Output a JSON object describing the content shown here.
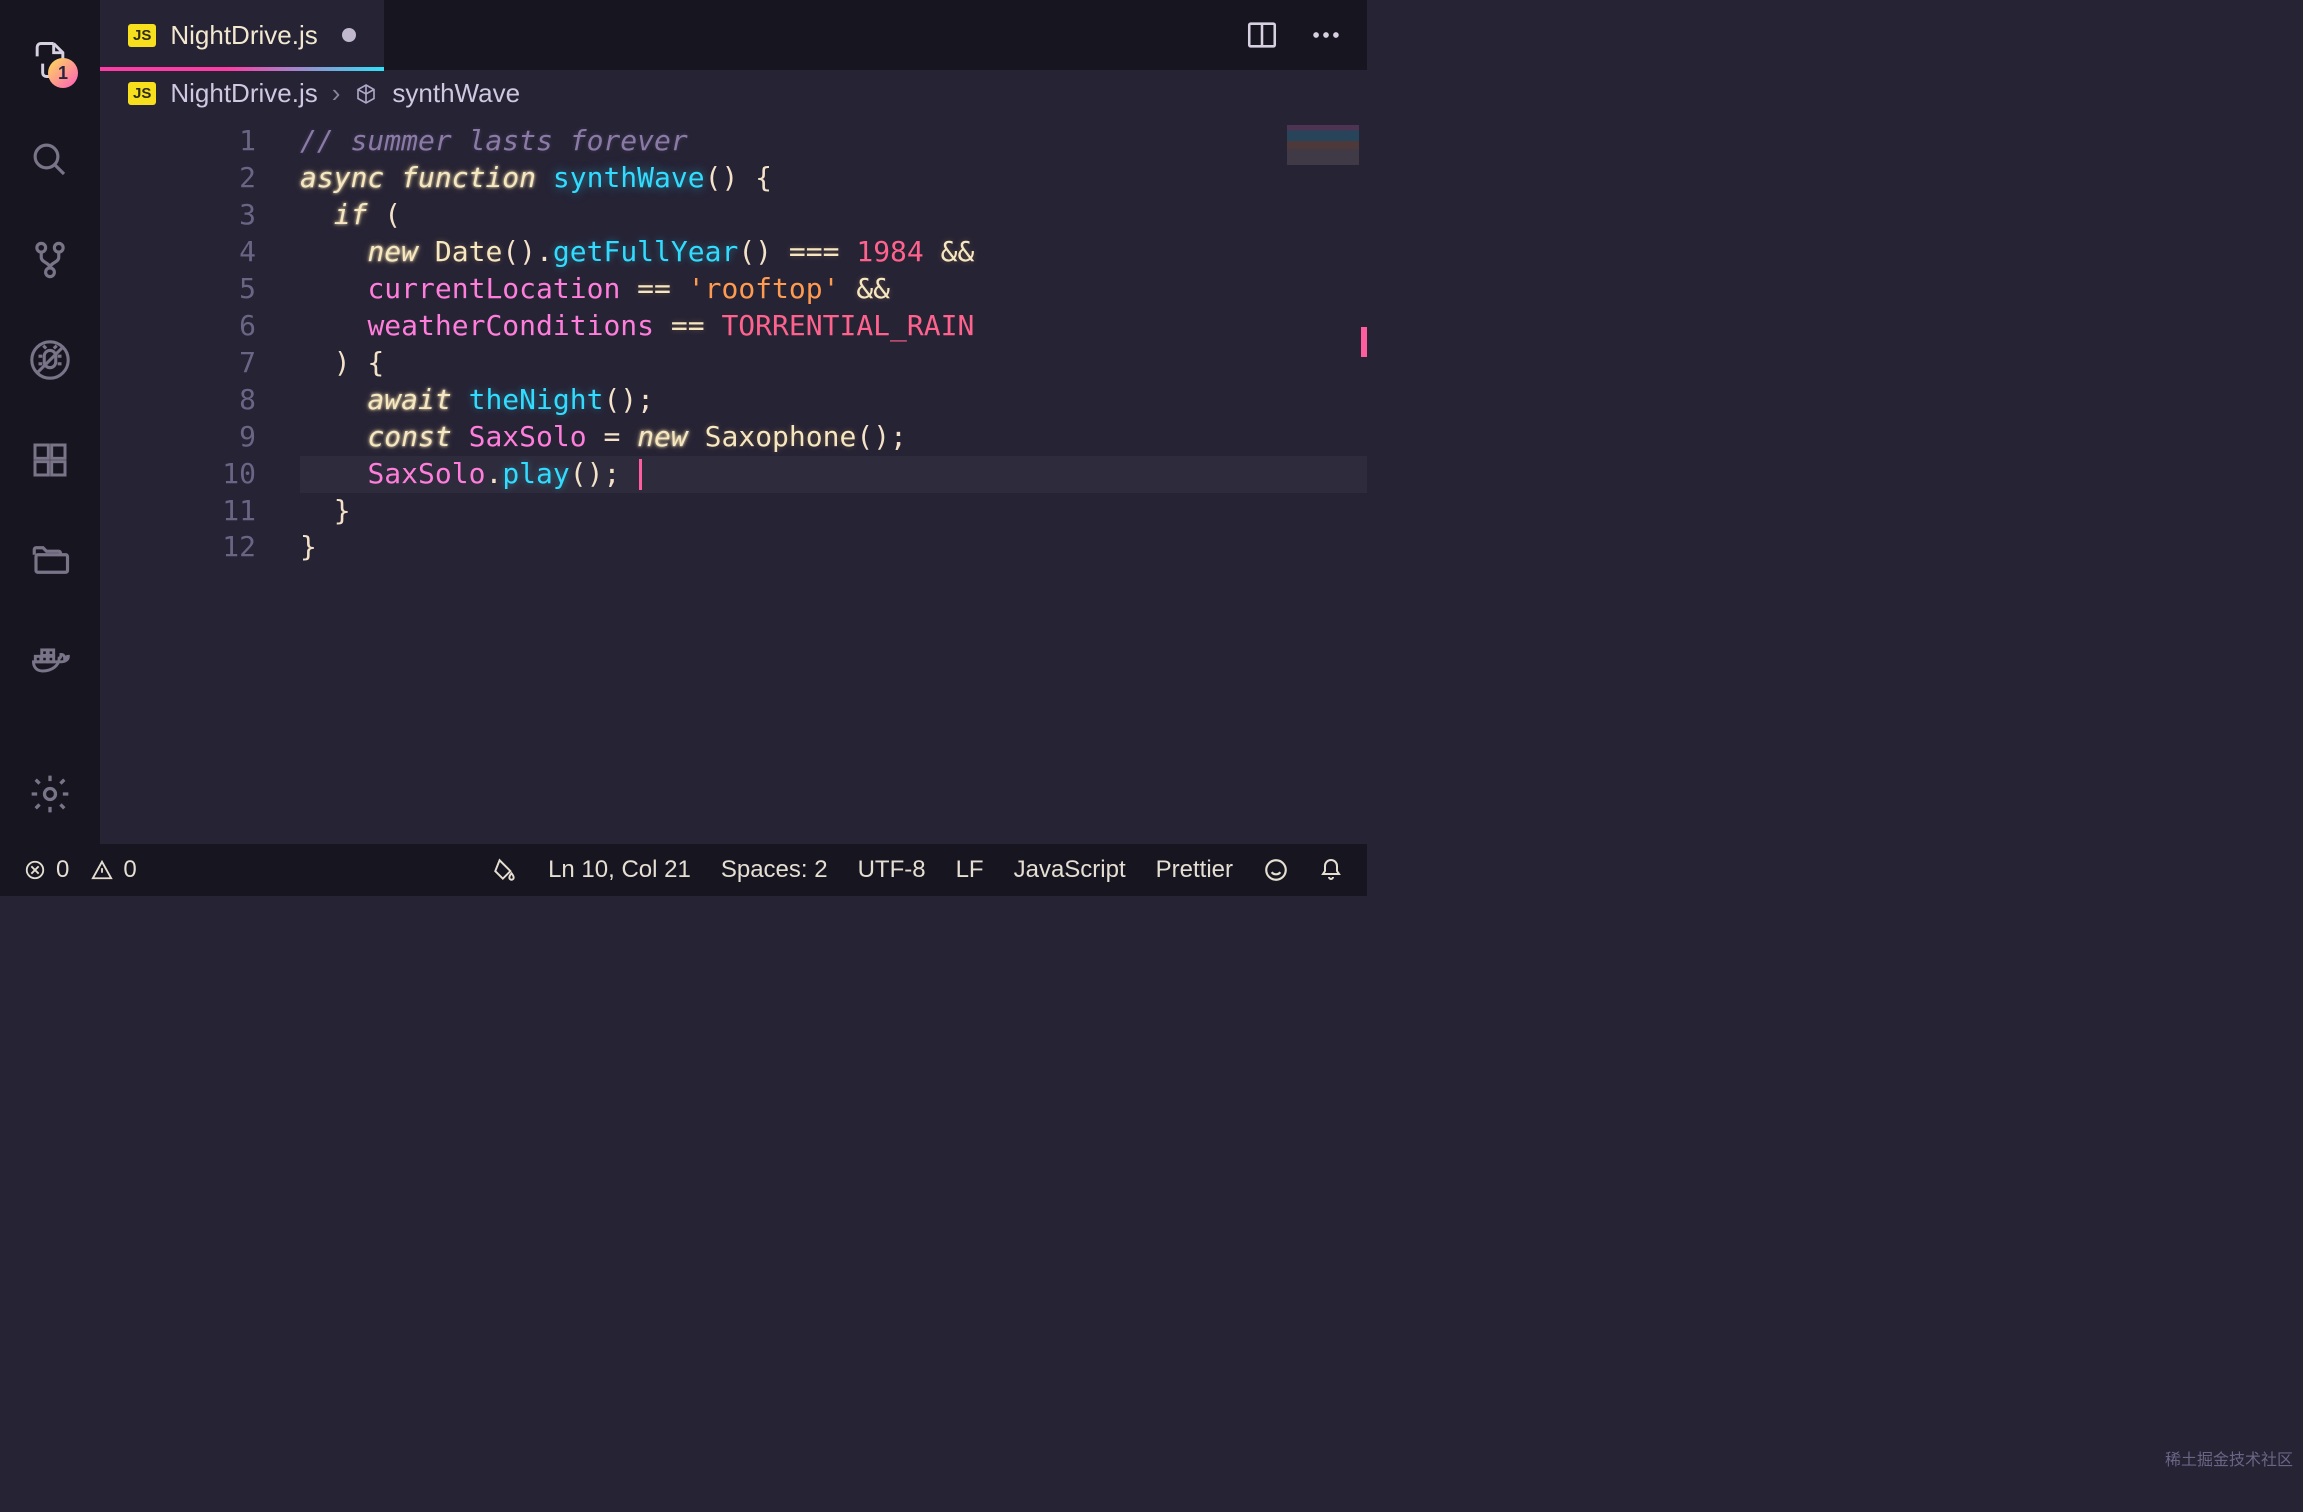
{
  "activitybar": {
    "badgeCount": "1"
  },
  "tab": {
    "fileName": "NightDrive.js",
    "lang": "JS"
  },
  "breadcrumb": {
    "file": "NightDrive.js",
    "symbol": "synthWave",
    "fileLang": "JS"
  },
  "editor": {
    "activeLine": 10,
    "lines": [
      {
        "n": "1",
        "tokens": [
          {
            "t": "// summer lasts forever",
            "c": "c-comment"
          }
        ]
      },
      {
        "n": "2",
        "tokens": [
          {
            "t": "async",
            "c": "c-kw"
          },
          {
            "t": " "
          },
          {
            "t": "function",
            "c": "c-kw"
          },
          {
            "t": " "
          },
          {
            "t": "synthWave",
            "c": "c-func"
          },
          {
            "t": "() {",
            "c": "c-punc"
          }
        ]
      },
      {
        "n": "3",
        "tokens": [
          {
            "t": "  "
          },
          {
            "t": "if",
            "c": "c-kw"
          },
          {
            "t": " (",
            "c": "c-punc"
          }
        ]
      },
      {
        "n": "4",
        "tokens": [
          {
            "t": "    "
          },
          {
            "t": "new",
            "c": "c-kw"
          },
          {
            "t": " "
          },
          {
            "t": "Date",
            "c": "c-type"
          },
          {
            "t": "().",
            "c": "c-punc"
          },
          {
            "t": "getFullYear",
            "c": "c-call"
          },
          {
            "t": "() ",
            "c": "c-punc"
          },
          {
            "t": "===",
            "c": "c-op"
          },
          {
            "t": " "
          },
          {
            "t": "1984",
            "c": "c-num"
          },
          {
            "t": " "
          },
          {
            "t": "&&",
            "c": "c-op"
          }
        ]
      },
      {
        "n": "5",
        "tokens": [
          {
            "t": "    "
          },
          {
            "t": "currentLocation",
            "c": "c-var"
          },
          {
            "t": " "
          },
          {
            "t": "==",
            "c": "c-op"
          },
          {
            "t": " "
          },
          {
            "t": "'rooftop'",
            "c": "c-str"
          },
          {
            "t": " "
          },
          {
            "t": "&&",
            "c": "c-op"
          }
        ]
      },
      {
        "n": "6",
        "tokens": [
          {
            "t": "    "
          },
          {
            "t": "weatherConditions",
            "c": "c-var"
          },
          {
            "t": " "
          },
          {
            "t": "==",
            "c": "c-op"
          },
          {
            "t": " "
          },
          {
            "t": "TORRENTIAL_RAIN",
            "c": "c-const"
          }
        ]
      },
      {
        "n": "7",
        "tokens": [
          {
            "t": "  ) {",
            "c": "c-punc"
          }
        ]
      },
      {
        "n": "8",
        "tokens": [
          {
            "t": "    "
          },
          {
            "t": "await",
            "c": "c-kw"
          },
          {
            "t": " "
          },
          {
            "t": "theNight",
            "c": "c-call"
          },
          {
            "t": "();",
            "c": "c-punc"
          }
        ]
      },
      {
        "n": "9",
        "tokens": [
          {
            "t": "    "
          },
          {
            "t": "const",
            "c": "c-kw"
          },
          {
            "t": " "
          },
          {
            "t": "SaxSolo",
            "c": "c-var"
          },
          {
            "t": " = ",
            "c": "c-punc"
          },
          {
            "t": "new",
            "c": "c-kw"
          },
          {
            "t": " "
          },
          {
            "t": "Saxophone",
            "c": "c-type"
          },
          {
            "t": "();",
            "c": "c-punc"
          }
        ]
      },
      {
        "n": "10",
        "tokens": [
          {
            "t": "    "
          },
          {
            "t": "SaxSolo",
            "c": "c-prop"
          },
          {
            "t": ".",
            "c": "c-punc"
          },
          {
            "t": "play",
            "c": "c-call"
          },
          {
            "t": "();",
            "c": "c-punc"
          },
          {
            "t": " ",
            "c": ""
          }
        ]
      },
      {
        "n": "11",
        "tokens": [
          {
            "t": "  }",
            "c": "c-punc"
          }
        ]
      },
      {
        "n": "12",
        "tokens": [
          {
            "t": "}",
            "c": "c-punc"
          }
        ]
      }
    ]
  },
  "statusbar": {
    "errors": "0",
    "warnings": "0",
    "cursor": "Ln 10, Col 21",
    "spaces": "Spaces: 2",
    "encoding": "UTF-8",
    "eol": "LF",
    "language": "JavaScript",
    "formatter": "Prettier"
  },
  "watermark": "稀土掘金技术社区"
}
